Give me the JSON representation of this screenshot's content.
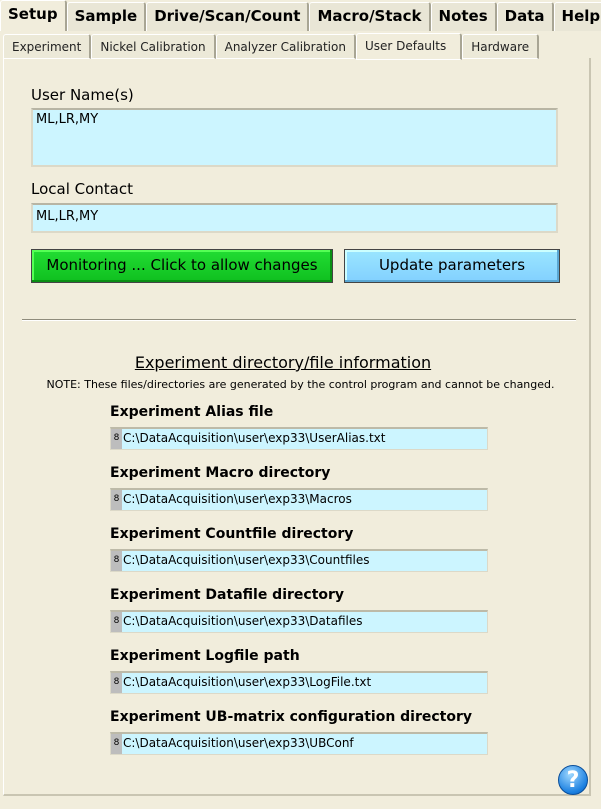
{
  "tabs": [
    "Setup",
    "Sample",
    "Drive/Scan/Count",
    "Macro/Stack",
    "Notes",
    "Data",
    "Help"
  ],
  "subtabs": [
    "Experiment",
    "Nickel Calibration",
    "Analyzer Calibration",
    "User Defaults",
    "Hardware"
  ],
  "user_names": {
    "label": "User Name(s)",
    "value": "ML,LR,MY"
  },
  "local_contact": {
    "label": "Local Contact",
    "value": "ML,LR,MY"
  },
  "buttons": {
    "monitor": "Monitoring ... Click to allow changes",
    "update": "Update parameters"
  },
  "section": {
    "title": "Experiment directory/file information",
    "note": "NOTE: These files/directories are generated by the control program and cannot be changed."
  },
  "paths": [
    {
      "label": "Experiment Alias file",
      "value": "C:\\DataAcquisition\\user\\exp33\\UserAlias.txt"
    },
    {
      "label": "Experiment Macro directory",
      "value": "C:\\DataAcquisition\\user\\exp33\\Macros"
    },
    {
      "label": "Experiment Countfile directory",
      "value": "C:\\DataAcquisition\\user\\exp33\\Countfiles"
    },
    {
      "label": "Experiment Datafile directory",
      "value": "C:\\DataAcquisition\\user\\exp33\\Datafiles"
    },
    {
      "label": "Experiment Logfile path",
      "value": "C:\\DataAcquisition\\user\\exp33\\LogFile.txt"
    },
    {
      "label": "Experiment UB-matrix configuration directory",
      "value": "C:\\DataAcquisition\\user\\exp33\\UBConf"
    }
  ],
  "help_glyph": "?",
  "grip_glyph": "8",
  "colors": {
    "field": "#ccf5ff",
    "monitor_button": "#14cc24",
    "update_button": "#8ddcff",
    "background": "#f1eddc"
  }
}
